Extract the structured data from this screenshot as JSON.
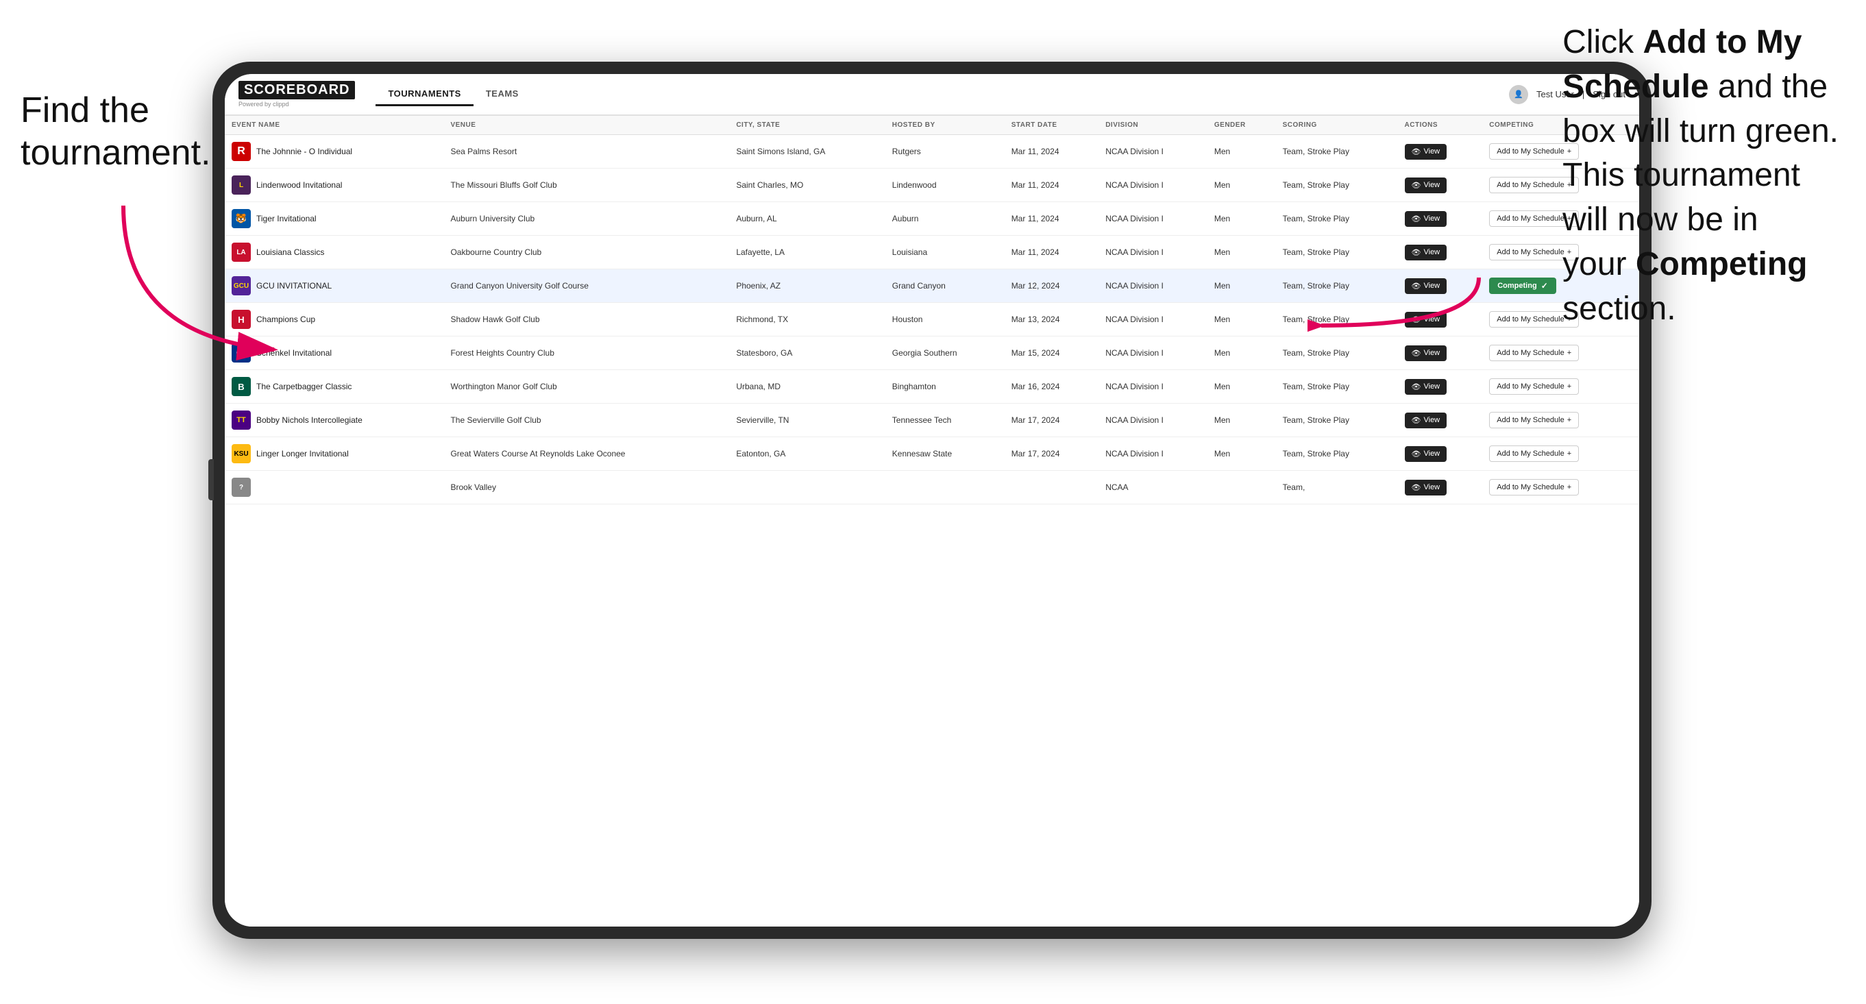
{
  "annotations": {
    "left": "Find the\ntournament.",
    "right_line1": "Click ",
    "right_bold1": "Add to My\nSchedule",
    "right_line2": " and the\nbox will turn green.\nThis tournament\nwill now be in\nyour ",
    "right_bold2": "Competing",
    "right_line3": "\nsection."
  },
  "header": {
    "logo": "SCOREBOARD",
    "powered_by": "Powered by clippd",
    "nav_tabs": [
      "TOURNAMENTS",
      "TEAMS"
    ],
    "active_tab": "TOURNAMENTS",
    "user_name": "Test User",
    "sign_out": "Sign out"
  },
  "table": {
    "columns": [
      "EVENT NAME",
      "VENUE",
      "CITY, STATE",
      "HOSTED BY",
      "START DATE",
      "DIVISION",
      "GENDER",
      "SCORING",
      "ACTIONS",
      "COMPETING"
    ],
    "rows": [
      {
        "logo_class": "logo-r",
        "logo_text": "R",
        "event_name": "The Johnnie - O Individual",
        "venue": "Sea Palms Resort",
        "city_state": "Saint Simons Island, GA",
        "hosted_by": "Rutgers",
        "start_date": "Mar 11, 2024",
        "division": "NCAA Division I",
        "gender": "Men",
        "scoring": "Team, Stroke Play",
        "action": "view",
        "competing_status": "add",
        "highlighted": false
      },
      {
        "logo_class": "logo-lindenwood",
        "logo_text": "L",
        "event_name": "Lindenwood Invitational",
        "venue": "The Missouri Bluffs Golf Club",
        "city_state": "Saint Charles, MO",
        "hosted_by": "Lindenwood",
        "start_date": "Mar 11, 2024",
        "division": "NCAA Division I",
        "gender": "Men",
        "scoring": "Team, Stroke Play",
        "action": "view",
        "competing_status": "add",
        "highlighted": false
      },
      {
        "logo_class": "logo-auburn",
        "logo_text": "🐯",
        "event_name": "Tiger Invitational",
        "venue": "Auburn University Club",
        "city_state": "Auburn, AL",
        "hosted_by": "Auburn",
        "start_date": "Mar 11, 2024",
        "division": "NCAA Division I",
        "gender": "Men",
        "scoring": "Team, Stroke Play",
        "action": "view",
        "competing_status": "add",
        "highlighted": false
      },
      {
        "logo_class": "logo-louisiana",
        "logo_text": "LA",
        "event_name": "Louisiana Classics",
        "venue": "Oakbourne Country Club",
        "city_state": "Lafayette, LA",
        "hosted_by": "Louisiana",
        "start_date": "Mar 11, 2024",
        "division": "NCAA Division I",
        "gender": "Men",
        "scoring": "Team, Stroke Play",
        "action": "view",
        "competing_status": "add",
        "highlighted": false
      },
      {
        "logo_class": "logo-gcu",
        "logo_text": "GCU",
        "event_name": "GCU INVITATIONAL",
        "venue": "Grand Canyon University Golf Course",
        "city_state": "Phoenix, AZ",
        "hosted_by": "Grand Canyon",
        "start_date": "Mar 12, 2024",
        "division": "NCAA Division I",
        "gender": "Men",
        "scoring": "Team, Stroke Play",
        "action": "view",
        "competing_status": "competing",
        "highlighted": true
      },
      {
        "logo_class": "logo-houston",
        "logo_text": "H",
        "event_name": "Champions Cup",
        "venue": "Shadow Hawk Golf Club",
        "city_state": "Richmond, TX",
        "hosted_by": "Houston",
        "start_date": "Mar 13, 2024",
        "division": "NCAA Division I",
        "gender": "Men",
        "scoring": "Team, Stroke Play",
        "action": "view",
        "competing_status": "add",
        "highlighted": false
      },
      {
        "logo_class": "logo-georgia",
        "logo_text": "GS",
        "event_name": "Schenkel Invitational",
        "venue": "Forest Heights Country Club",
        "city_state": "Statesboro, GA",
        "hosted_by": "Georgia Southern",
        "start_date": "Mar 15, 2024",
        "division": "NCAA Division I",
        "gender": "Men",
        "scoring": "Team, Stroke Play",
        "action": "view",
        "competing_status": "add",
        "highlighted": false
      },
      {
        "logo_class": "logo-binghamton",
        "logo_text": "B",
        "event_name": "The Carpetbagger Classic",
        "venue": "Worthington Manor Golf Club",
        "city_state": "Urbana, MD",
        "hosted_by": "Binghamton",
        "start_date": "Mar 16, 2024",
        "division": "NCAA Division I",
        "gender": "Men",
        "scoring": "Team, Stroke Play",
        "action": "view",
        "competing_status": "add",
        "highlighted": false
      },
      {
        "logo_class": "logo-tn-tech",
        "logo_text": "TT",
        "event_name": "Bobby Nichols Intercollegiate",
        "venue": "The Sevierville Golf Club",
        "city_state": "Sevierville, TN",
        "hosted_by": "Tennessee Tech",
        "start_date": "Mar 17, 2024",
        "division": "NCAA Division I",
        "gender": "Men",
        "scoring": "Team, Stroke Play",
        "action": "view",
        "competing_status": "add",
        "highlighted": false
      },
      {
        "logo_class": "logo-kennesaw",
        "logo_text": "KSU",
        "event_name": "Linger Longer Invitational",
        "venue": "Great Waters Course At Reynolds Lake Oconee",
        "city_state": "Eatonton, GA",
        "hosted_by": "Kennesaw State",
        "start_date": "Mar 17, 2024",
        "division": "NCAA Division I",
        "gender": "Men",
        "scoring": "Team, Stroke Play",
        "action": "view",
        "competing_status": "add",
        "highlighted": false
      },
      {
        "logo_class": "logo-default",
        "logo_text": "?",
        "event_name": "",
        "venue": "Brook Valley",
        "city_state": "",
        "hosted_by": "",
        "start_date": "",
        "division": "NCAA",
        "gender": "",
        "scoring": "Team,",
        "action": "view",
        "competing_status": "add",
        "highlighted": false
      }
    ],
    "view_label": "View",
    "add_label": "Add to My Schedule",
    "competing_label": "Competing"
  }
}
